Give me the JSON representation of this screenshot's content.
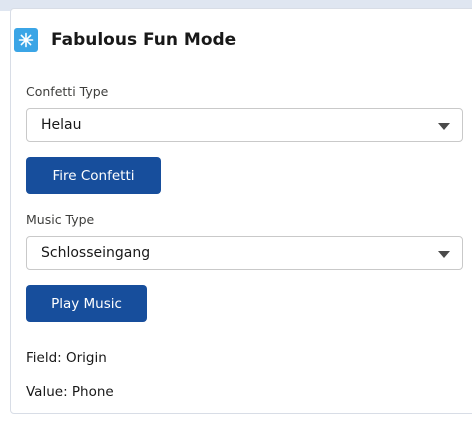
{
  "card": {
    "title": "Fabulous Fun Mode",
    "icon": "sparkle-icon",
    "accent_color": "#3ba5e6"
  },
  "confetti": {
    "label": "Confetti Type",
    "value": "Helau",
    "button_label": "Fire Confetti"
  },
  "music": {
    "label": "Music Type",
    "value": "Schlosseingang",
    "button_label": "Play Music"
  },
  "info": {
    "field": "Field: Origin",
    "value": "Value: Phone"
  },
  "colors": {
    "button": "#174e9c",
    "text": "#181818"
  }
}
